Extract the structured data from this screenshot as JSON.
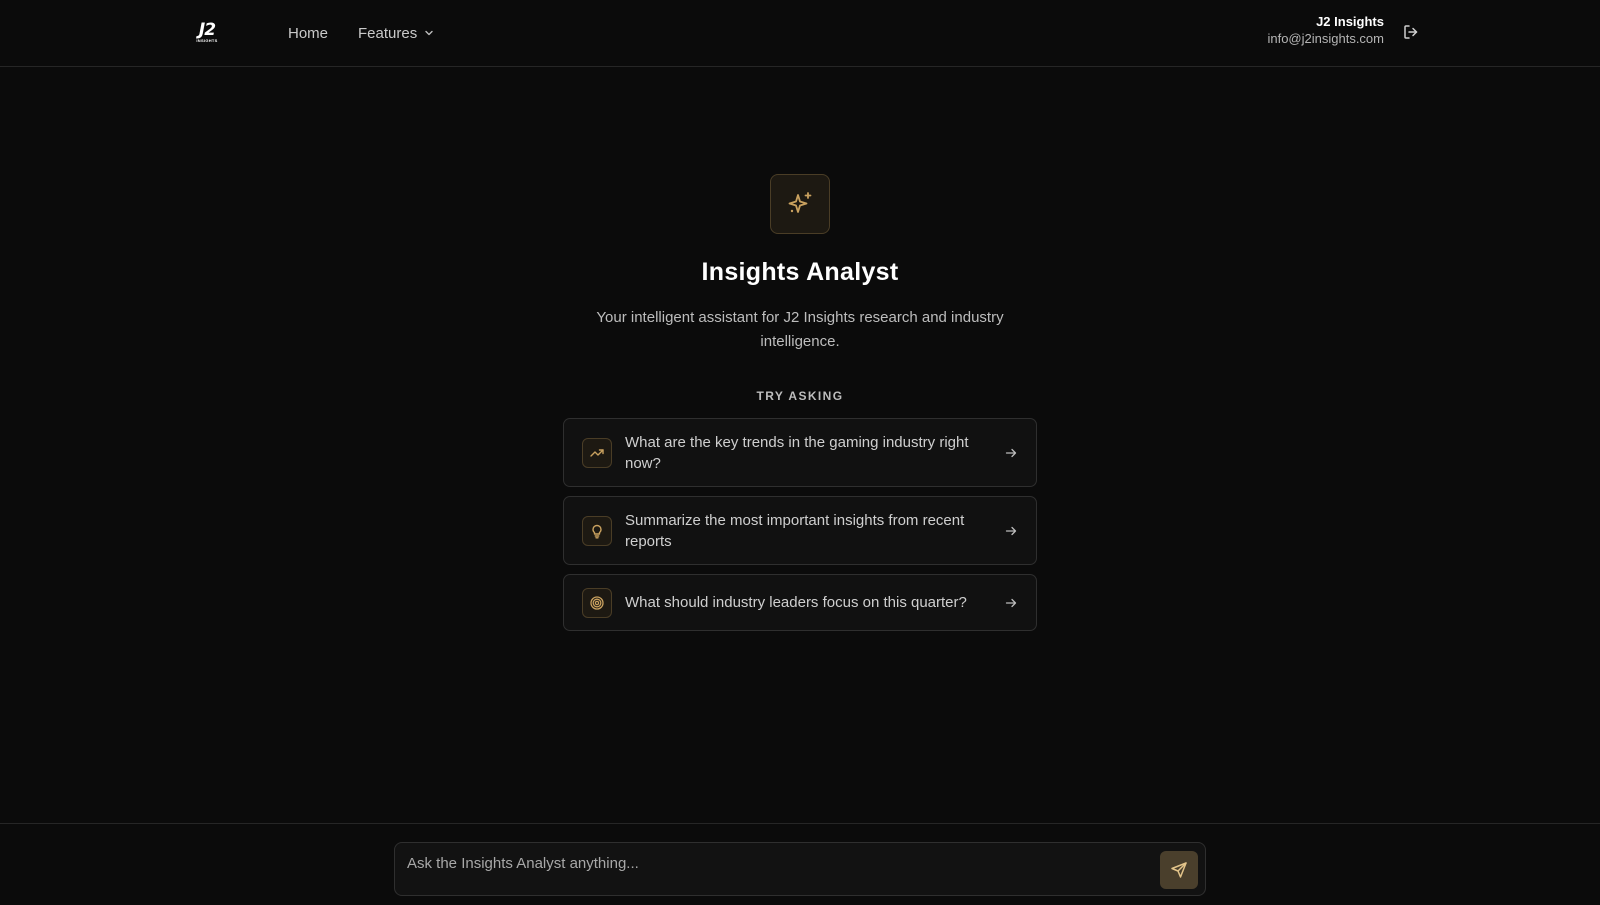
{
  "brand": {
    "logo_mark": "J2",
    "logo_sub": "INSIGHTS"
  },
  "nav": {
    "items": [
      {
        "label": "Home"
      },
      {
        "label": "Features"
      }
    ]
  },
  "user": {
    "name": "J2 Insights",
    "email": "info@j2insights.com"
  },
  "hero": {
    "icon": "sparkles-icon",
    "title": "Insights Analyst",
    "subtitle": "Your intelligent assistant for J2 Insights research and industry intelligence."
  },
  "suggestions": {
    "label": "TRY ASKING",
    "items": [
      {
        "icon": "trending-up-icon",
        "text": "What are the key trends in the gaming industry right now?"
      },
      {
        "icon": "lightbulb-icon",
        "text": "Summarize the most important insights from recent reports"
      },
      {
        "icon": "target-icon",
        "text": "What should industry leaders focus on this quarter?"
      }
    ]
  },
  "chat": {
    "placeholder": "Ask the Insights Analyst anything..."
  },
  "colors": {
    "background": "#0b0b0b",
    "accent": "#c9a15f",
    "accent_bg": "#1d1912",
    "send_button": "#4a3f2c"
  }
}
